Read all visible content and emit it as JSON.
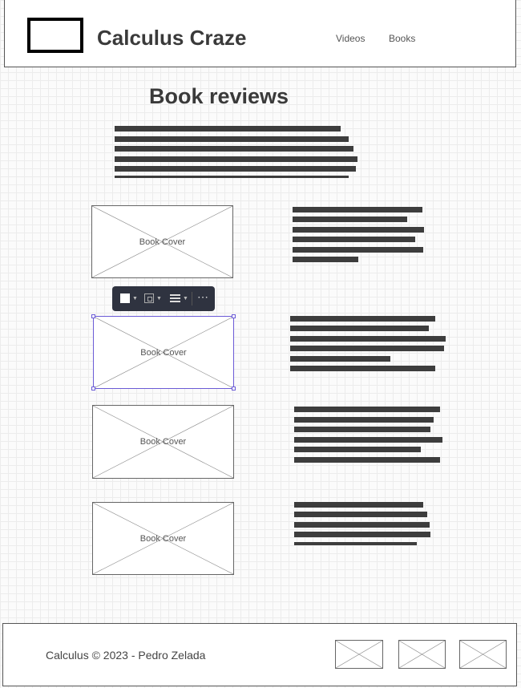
{
  "header": {
    "site_title": "Calculus Craze",
    "nav": [
      {
        "label": "Videos"
      },
      {
        "label": "Books"
      }
    ]
  },
  "main": {
    "page_title": "Book reviews",
    "books": [
      {
        "cover_label": "Book Cover"
      },
      {
        "cover_label": "Book Cover"
      },
      {
        "cover_label": "Book Cover"
      },
      {
        "cover_label": "Book Cover"
      }
    ]
  },
  "toolbar": {
    "more_label": "⋯"
  },
  "footer": {
    "text": "Calculus © 2023 - Pedro Zelada"
  },
  "colors": {
    "text_bar": "#3d3d3d",
    "selection": "#6b5bd6",
    "toolbar_bg": "#2f3340"
  }
}
